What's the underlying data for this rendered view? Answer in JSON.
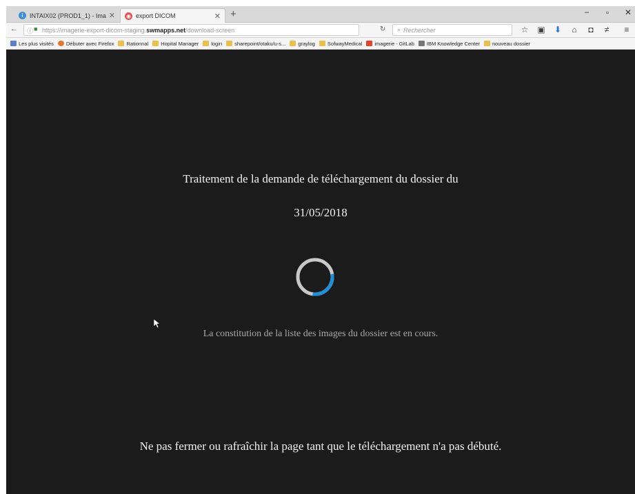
{
  "browser": {
    "tabs": [
      {
        "title": "INTAIX02 (PROD1_1) - Ima...",
        "favicon": "info-globe-icon"
      },
      {
        "title": "export DICOM",
        "favicon": "app-red-icon"
      }
    ],
    "url_prefix": "https://imagerie-export-dicom-staging.",
    "url_host": "swmapps.net",
    "url_path": "/download-screen",
    "search_placeholder": "Rechercher",
    "bookmarks": [
      {
        "label": "Les plus visités",
        "icon": "most-visited-icon"
      },
      {
        "label": "Débuter avec Firefox",
        "icon": "firefox-icon"
      },
      {
        "label": "Rationnal",
        "icon": "folder-icon"
      },
      {
        "label": "Hopital Manager",
        "icon": "folder-icon"
      },
      {
        "label": "login",
        "icon": "folder-icon"
      },
      {
        "label": "sharepoint/otaku/u-s...",
        "icon": "folder-icon"
      },
      {
        "label": "graylog",
        "icon": "folder-icon"
      },
      {
        "label": "SofwayMedical",
        "icon": "folder-icon"
      },
      {
        "label": "imagerie - GitLab",
        "icon": "gitlab-icon"
      },
      {
        "label": "IBM Knowledge Center",
        "icon": "ibm-icon"
      },
      {
        "label": "nouveau dossier",
        "icon": "folder-icon"
      }
    ]
  },
  "page": {
    "title_line": "Traitement de la demande de téléchargement du dossier du",
    "date": "31/05/2018",
    "status": "La constitution de la liste des images du dossier est en cours.",
    "warning": "Ne pas fermer ou rafraîchir la page tant que le téléchargement n'a pas débuté.",
    "spinner_progress": 0.3,
    "colors": {
      "background": "#1b1b1b",
      "spinner_track": "#c8c8c8",
      "spinner_arc": "#1e90d8"
    }
  }
}
